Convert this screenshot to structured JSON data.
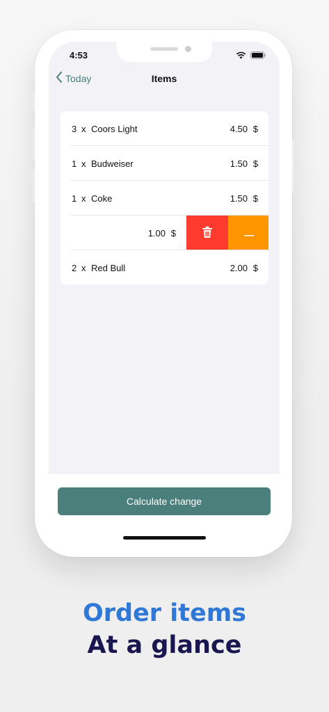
{
  "status_bar": {
    "time": "4:53"
  },
  "nav": {
    "back_label": "Today",
    "title": "Items"
  },
  "items": [
    {
      "qty": "3",
      "x": "x",
      "name": "Coors Light",
      "price": "4.50",
      "currency": "$"
    },
    {
      "qty": "1",
      "x": "x",
      "name": "Budweiser",
      "price": "1.50",
      "currency": "$"
    },
    {
      "qty": "1",
      "x": "x",
      "name": "Coke",
      "price": "1.50",
      "currency": "$"
    },
    {
      "price": "1.00",
      "currency": "$"
    },
    {
      "qty": "2",
      "x": "x",
      "name": "Red Bull",
      "price": "2.00",
      "currency": "$"
    }
  ],
  "actions": {
    "calculate_label": "Calculate change"
  },
  "captions": {
    "line1": "Order items",
    "line2": "At a glance"
  },
  "colors": {
    "accent": "#4a7f7b",
    "delete": "#ff3b30",
    "decrement": "#ff9500",
    "caption_blue": "#2f78d6",
    "caption_navy": "#1a1650"
  }
}
